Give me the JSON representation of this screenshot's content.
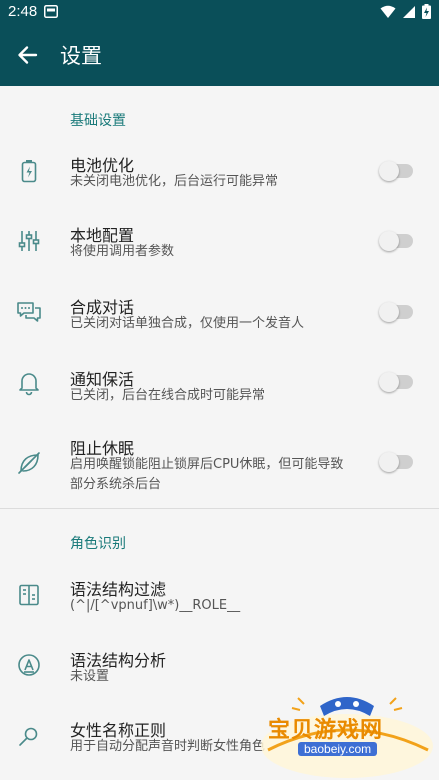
{
  "status_bar": {
    "time": "2:48"
  },
  "app_bar": {
    "title": "设置"
  },
  "sections": [
    {
      "header": "基础设置",
      "items": [
        {
          "title": "电池优化",
          "summary": "未关闭电池优化，后台运行可能异常",
          "icon": "battery-icon",
          "switch_on": false
        },
        {
          "title": "本地配置",
          "summary": "将使用调用者参数",
          "icon": "sliders-icon",
          "switch_on": false
        },
        {
          "title": "合成对话",
          "summary": "已关闭对话单独合成，仅使用一个发音人",
          "icon": "chat-icon",
          "switch_on": false
        },
        {
          "title": "通知保活",
          "summary": "已关闭，后台在线合成时可能异常",
          "icon": "bell-icon",
          "switch_on": false
        },
        {
          "title": "阻止休眠",
          "summary_line1": "启用唤醒锁能阻止锁屏后CPU休眠，但可能导致",
          "summary_line2": "部分系统杀后台",
          "icon": "leaf-off-icon",
          "switch_on": false
        }
      ]
    },
    {
      "header": "角色识别",
      "items": [
        {
          "title": "语法结构过滤",
          "summary": "(^|/[^vpnuf]\\w*)__ROLE__",
          "icon": "filter-panel-icon"
        },
        {
          "title": "语法结构分析",
          "summary": "未设置",
          "icon": "circle-a-icon"
        },
        {
          "title": "女性名称正则",
          "summary": "用于自动分配声音时判断女性角色",
          "icon": "search-regex-icon"
        }
      ]
    }
  ],
  "watermark": {
    "text": "宝贝游戏网",
    "url": "baobeiy.com"
  },
  "colors": {
    "app_bar": "#0a4f59",
    "accent": "#1a7a7a",
    "background": "#f5f5f5"
  }
}
